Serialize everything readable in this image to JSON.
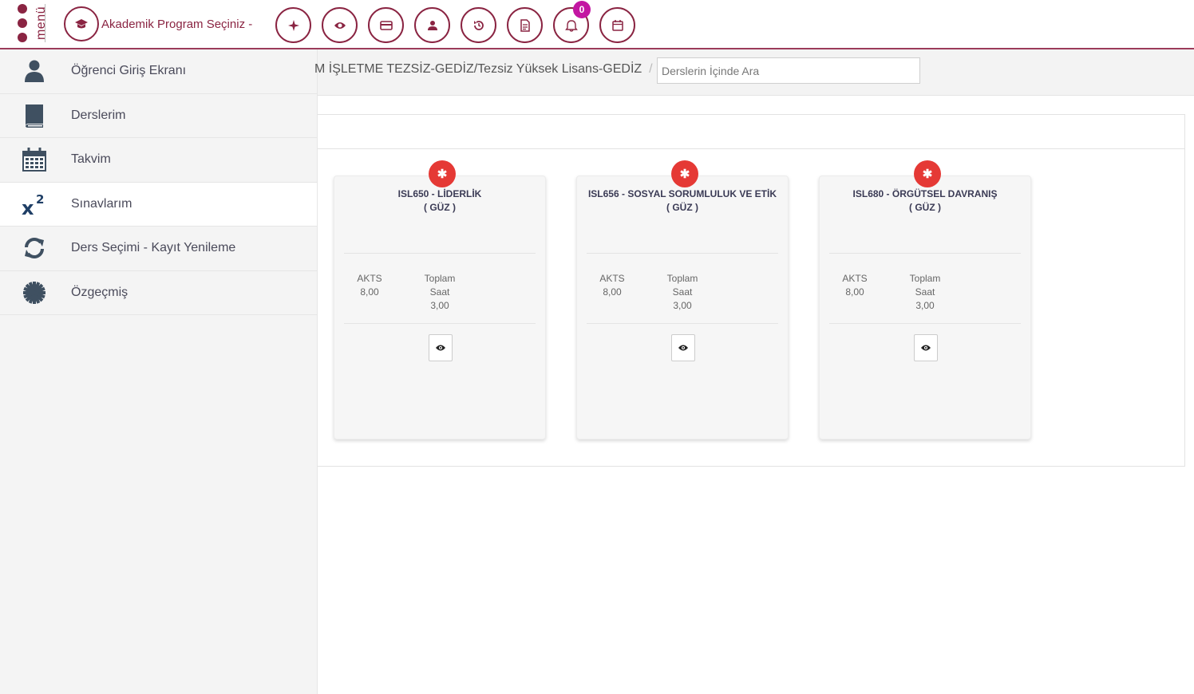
{
  "brand": {
    "menu_label": "menü"
  },
  "header": {
    "program_select_label": "Akademik Program Seçiniz -",
    "notification_count": "0",
    "icons": [
      "graduation-cap-icon",
      "compass-icon",
      "eye-icon",
      "credit-card-icon",
      "user-icon",
      "history-icon",
      "document-icon",
      "bell-icon",
      "calendar-icon"
    ]
  },
  "sidebar": {
    "items": [
      {
        "label": "Öğrenci Giriş Ekranı",
        "icon": "user-icon"
      },
      {
        "label": "Derslerim",
        "icon": "book-icon"
      },
      {
        "label": "Takvim",
        "icon": "calendar-icon"
      },
      {
        "label": "Sınavlarım",
        "icon": "superscript-icon"
      },
      {
        "label": "Ders Seçimi - Kayıt Yenileme",
        "icon": "refresh-icon"
      },
      {
        "label": "Özgeçmiş",
        "icon": "gear-icon"
      }
    ]
  },
  "breadcrumb": {
    "path": "M İŞLETME TEZSİZ-GEDİZ/Tezsiz Yüksek Lisans-GEDİZ",
    "separator": "/"
  },
  "search": {
    "placeholder": "Derslerin İçinde Ara"
  },
  "courses": [
    {
      "title": "ISL650 - LİDERLİK",
      "term": "( GÜZ )",
      "akts_label": "AKTS",
      "akts": "8,00",
      "hours_label_1": "Toplam",
      "hours_label_2": "Saat",
      "hours": "3,00"
    },
    {
      "title": "ISL656 - SOSYAL SORUMLULUK VE ETİK",
      "term": "( GÜZ )",
      "akts_label": "AKTS",
      "akts": "8,00",
      "hours_label_1": "Toplam",
      "hours_label_2": "Saat",
      "hours": "3,00"
    },
    {
      "title": "ISL680 - ÖRGÜTSEL DAVRANIŞ",
      "term": "( GÜZ )",
      "akts_label": "AKTS",
      "akts": "8,00",
      "hours_label_1": "Toplam",
      "hours_label_2": "Saat",
      "hours": "3,00"
    }
  ],
  "colors": {
    "brand": "#8a2442",
    "badge": "#c316a2",
    "star": "#e53935",
    "sidebar_bg": "#f4f4f4",
    "sidebar_icon": "#3f5061"
  }
}
